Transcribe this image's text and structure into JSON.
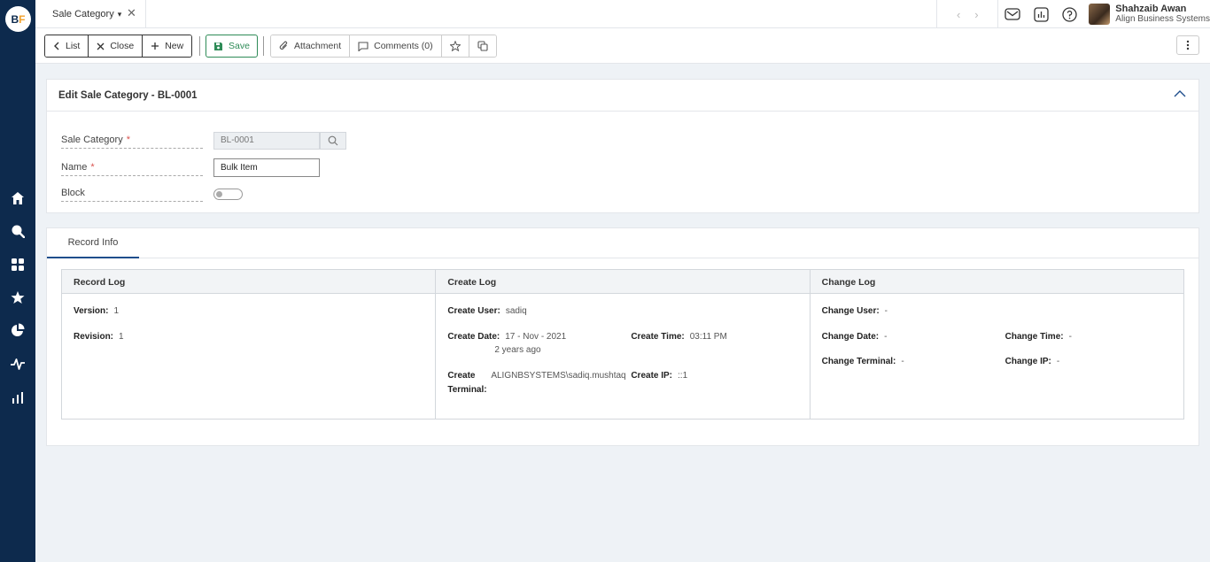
{
  "app": {
    "logo_left": "B",
    "logo_right": "F"
  },
  "tab": {
    "title": "Sale Category",
    "caret": "▾",
    "close": "✕"
  },
  "topbar": {
    "prev": "‹",
    "next": "›",
    "user_name": "Shahzaib Awan",
    "user_org": "Align Business Systems"
  },
  "toolbar": {
    "list_label": "List",
    "close_label": "Close",
    "new_label": "New",
    "save_label": "Save",
    "attachment_label": "Attachment",
    "comments_label": "Comments (0)"
  },
  "edit_panel": {
    "title": "Edit Sale Category - BL-0001",
    "fields": {
      "sale_category_label": "Sale Category",
      "sale_category_value": "BL-0001",
      "name_label": "Name",
      "name_value": "Bulk Item",
      "block_label": "Block",
      "required_mark": "*"
    }
  },
  "record_panel": {
    "tab_label": "Record Info",
    "record_log": {
      "title": "Record Log",
      "version_label": "Version:",
      "version_value": "1",
      "revision_label": "Revision:",
      "revision_value": "1"
    },
    "create_log": {
      "title": "Create Log",
      "user_label": "Create User:",
      "user_value": "sadiq",
      "date_label": "Create Date:",
      "date_value": "17 - Nov - 2021",
      "date_relative": "2 years ago",
      "time_label": "Create Time:",
      "time_value": "03:11 PM",
      "terminal_label_1": "Create",
      "terminal_label_2": "Terminal:",
      "terminal_value": "ALIGNBSYSTEMS\\sadiq.mushtaq",
      "ip_label": "Create IP:",
      "ip_value": "::1"
    },
    "change_log": {
      "title": "Change Log",
      "user_label": "Change User:",
      "user_value": "-",
      "date_label": "Change Date:",
      "date_value": "-",
      "time_label": "Change Time:",
      "time_value": "-",
      "terminal_label": "Change Terminal:",
      "terminal_value": "-",
      "ip_label": "Change IP:",
      "ip_value": "-"
    }
  },
  "colors": {
    "sidebar": "#0d2a4d",
    "accent": "#1f4e8c",
    "save": "#2e8b57",
    "required": "#d9534f"
  }
}
